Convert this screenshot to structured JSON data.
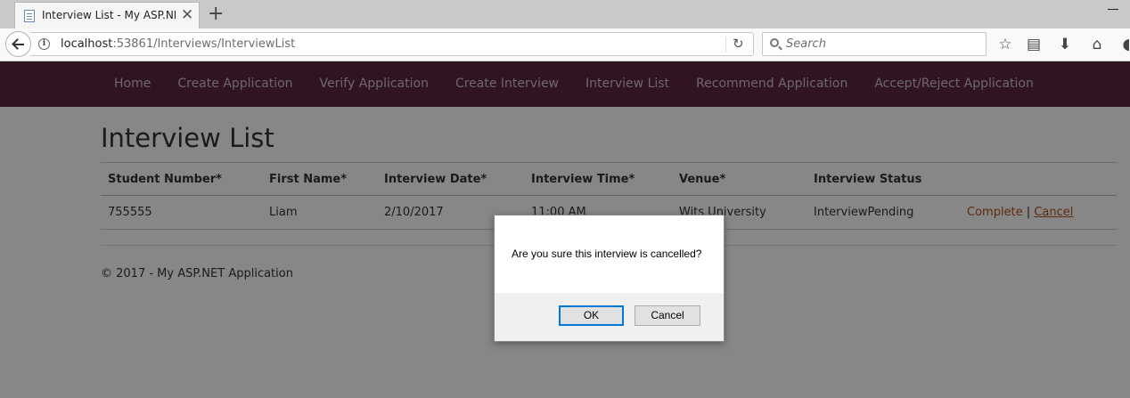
{
  "browser": {
    "tab_title": "Interview List - My ASP.NET",
    "url_host": "localhost",
    "url_path": ":53861/Interviews/InterviewList",
    "search_placeholder": "Search"
  },
  "nav": {
    "items": [
      {
        "label": "Home"
      },
      {
        "label": "Create Application"
      },
      {
        "label": "Verify Application"
      },
      {
        "label": "Create Interview"
      },
      {
        "label": "Interview List"
      },
      {
        "label": "Recommend Application"
      },
      {
        "label": "Accept/Reject Application"
      }
    ]
  },
  "page": {
    "title": "Interview List",
    "columns": [
      "Student Number*",
      "First Name*",
      "Interview Date*",
      "Interview Time*",
      "Venue*",
      "Interview Status"
    ],
    "rows": [
      {
        "student_number": "755555",
        "first_name": "Liam",
        "interview_date": "2/10/2017",
        "interview_time": "11:00 AM",
        "venue": "Wits University",
        "status": "InterviewPending",
        "action_complete": "Complete",
        "action_sep": "|",
        "action_cancel": "Cancel"
      }
    ],
    "footer": "© 2017 - My ASP.NET Application"
  },
  "dialog": {
    "message": "Are you sure this interview is cancelled?",
    "ok_label": "OK",
    "cancel_label": "Cancel"
  }
}
